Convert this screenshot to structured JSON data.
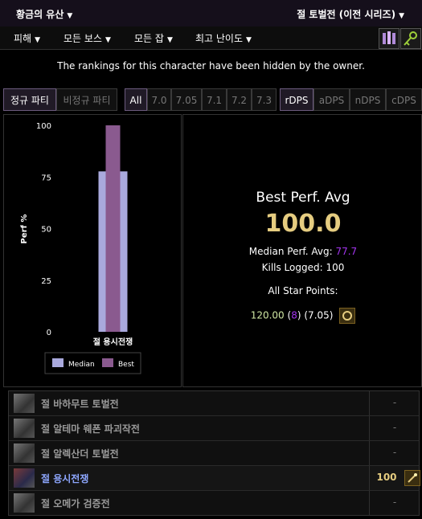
{
  "header": {
    "zone": "황금의 유산",
    "encounter_selector": "절 토벌전 (이전 시리즈)",
    "caret": "▼"
  },
  "nav": {
    "items": [
      "피해",
      "모든 보스",
      "모든 잡",
      "최고 난이도"
    ]
  },
  "notice": "The rankings for this character have been hidden by the owner.",
  "tabs": {
    "party": [
      "정규 파티",
      "비정규 파티"
    ],
    "patches": [
      "All",
      "7.0",
      "7.05",
      "7.1",
      "7.2",
      "7.3"
    ],
    "metrics": [
      "rDPS",
      "aDPS",
      "nDPS",
      "cDPS"
    ]
  },
  "chart_data": {
    "type": "bar",
    "categories": [
      "절 용시전쟁"
    ],
    "series": [
      {
        "name": "Median",
        "values": [
          77.7
        ],
        "color": "#a9a9dd"
      },
      {
        "name": "Best",
        "values": [
          100.0
        ],
        "color": "#8a5a8f"
      }
    ],
    "ylabel": "Perf %",
    "ylim": [
      0,
      100
    ],
    "yticks": [
      "100",
      "75",
      "50",
      "25",
      "0"
    ],
    "legend": "bottom"
  },
  "stats": {
    "best_label": "Best Perf. Avg",
    "best_value": "100.0",
    "median_label": "Median Perf. Avg:",
    "median_value": "77.7",
    "kills_label": "Kills Logged:",
    "kills_value": "100",
    "asp_label": "All Star Points:",
    "asp_points": "120.00",
    "asp_rank_open": "(",
    "asp_rank": "8",
    "asp_rank_close": ")",
    "asp_patch": "(7.05)"
  },
  "encounters": [
    {
      "name": "절 바하무트 토벌전",
      "score": "-"
    },
    {
      "name": "절 알테마 웨폰 파괴작전",
      "score": "-"
    },
    {
      "name": "절 알렉산더 토벌전",
      "score": "-"
    },
    {
      "name": "절 용시전쟁",
      "score": "100"
    },
    {
      "name": "절 오메가 검증전",
      "score": "-"
    }
  ]
}
